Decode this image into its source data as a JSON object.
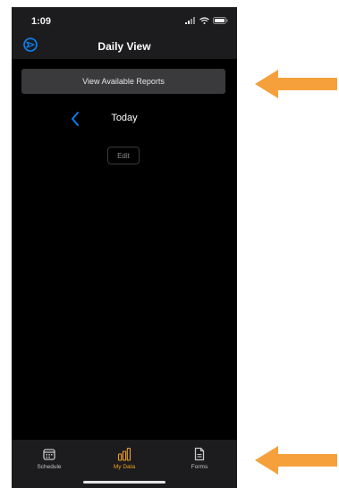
{
  "status_bar": {
    "time": "1:09"
  },
  "nav": {
    "title": "Daily View",
    "left_icon": "app-compass-icon"
  },
  "reports_button": {
    "label": "View Available Reports"
  },
  "date_nav": {
    "label": "Today",
    "back_icon": "chevron-left-icon"
  },
  "edit_button": {
    "label": "Edit"
  },
  "tabs": [
    {
      "label": "Schedule",
      "icon": "calendar-icon",
      "active": false
    },
    {
      "label": "My Data",
      "icon": "bar-chart-icon",
      "active": true
    },
    {
      "label": "Forms",
      "icon": "document-icon",
      "active": false
    }
  ],
  "colors": {
    "accent": "#f0a020",
    "annotation_arrow": "#f5a03a",
    "link_blue": "#0a84ff",
    "background": "#000000",
    "bar_background": "#1c1c1e"
  }
}
